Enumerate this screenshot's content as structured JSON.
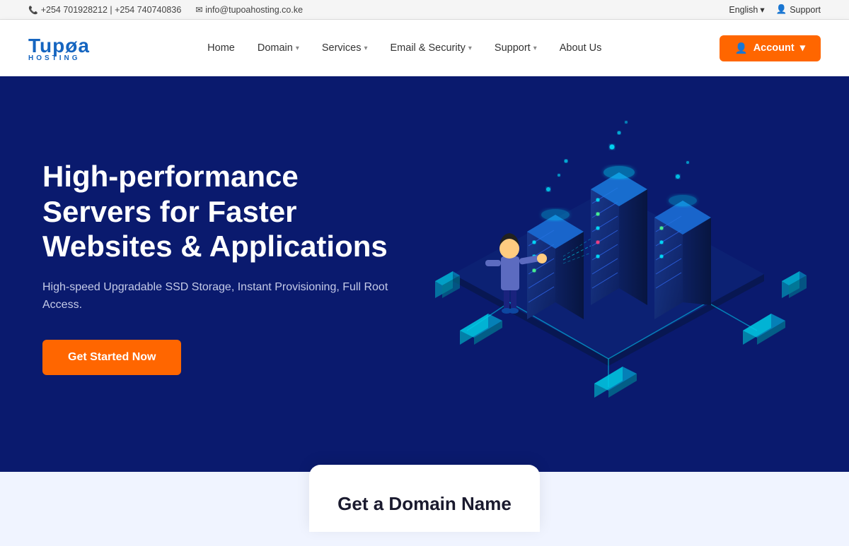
{
  "topbar": {
    "phone": "+254 701928212 | +254 740740836",
    "email": "info@tupoahosting.co.ke",
    "language": "English",
    "language_chevron": "▾",
    "support_icon": "👤",
    "support_label": "Support"
  },
  "navbar": {
    "logo_main": "Tupoa",
    "logo_sub": "HOSTING",
    "nav_items": [
      {
        "label": "Home",
        "has_dropdown": false
      },
      {
        "label": "Domain",
        "has_dropdown": true
      },
      {
        "label": "Services",
        "has_dropdown": true
      },
      {
        "label": "Email & Security",
        "has_dropdown": true
      },
      {
        "label": "Support",
        "has_dropdown": true
      },
      {
        "label": "About Us",
        "has_dropdown": false
      }
    ],
    "account_label": "Account"
  },
  "hero": {
    "title": "High-performance Servers for Faster Websites & Applications",
    "subtitle": "High-speed Upgradable SSD Storage, Instant Provisioning, Full Root Access.",
    "cta_label": "Get Started Now"
  },
  "domain_section": {
    "title": "Get a Domain Name"
  }
}
